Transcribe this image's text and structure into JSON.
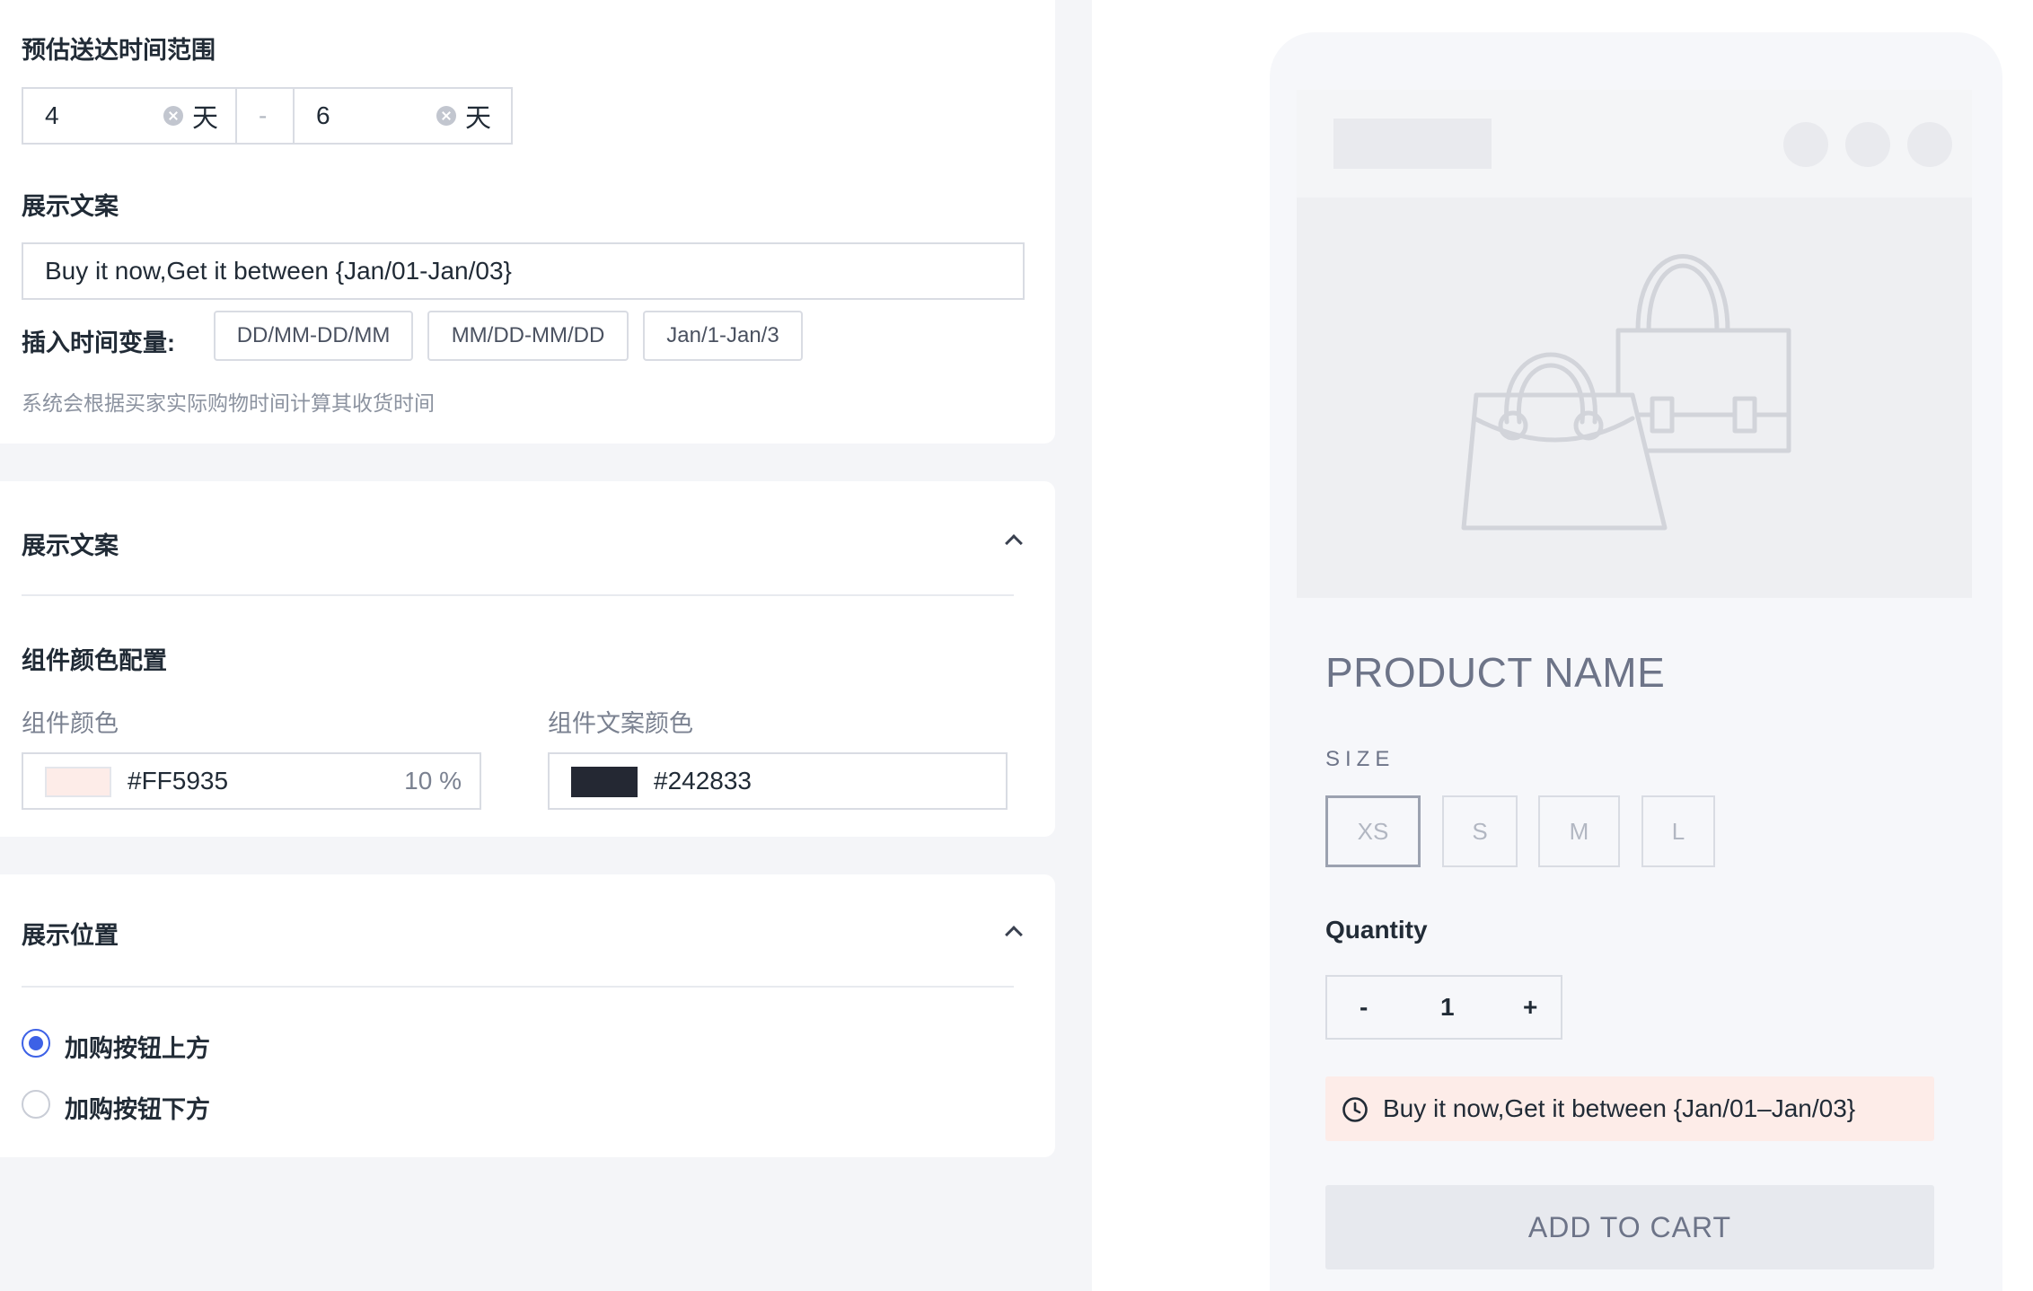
{
  "delivery_range": {
    "title": "预估送达时间范围",
    "min_value": "4",
    "max_value": "6",
    "unit": "天",
    "separator": "-"
  },
  "display_text": {
    "title": "展示文案",
    "value": "Buy it now,Get it between {Jan/01-Jan/03}",
    "insert_label": "插入时间变量:",
    "variables": [
      "DD/MM-DD/MM",
      "MM/DD-MM/DD",
      "Jan/1-Jan/3"
    ],
    "hint": "系统会根据买家实际购物时间计算其收货时间"
  },
  "appearance_section": {
    "title": "展示文案",
    "color_config_title": "组件颜色配置",
    "component_color_label": "组件颜色",
    "component_color_value": "#FF5935",
    "component_color_opacity": "10 %",
    "text_color_label": "组件文案颜色",
    "text_color_value": "#242833",
    "swatch_colors": {
      "component": "#fdece8",
      "text": "#242833"
    }
  },
  "position_section": {
    "title": "展示位置",
    "options": [
      {
        "label": "加购按钮上方",
        "checked": true
      },
      {
        "label": "加购按钮下方",
        "checked": false
      }
    ]
  },
  "preview": {
    "product_name": "PRODUCT NAME",
    "size_label": "SIZE",
    "sizes": [
      "XS",
      "S",
      "M",
      "L"
    ],
    "selected_size": "XS",
    "quantity_label": "Quantity",
    "quantity_minus": "-",
    "quantity_value": "1",
    "quantity_plus": "+",
    "delivery_message": "Buy it now,Get it between {Jan/01–Jan/03}",
    "delivery_icon": "clock-icon",
    "add_to_cart": "ADD TO CART"
  },
  "colors": {
    "accent": "#3d61e6",
    "delivery_bg": "#fdece8",
    "text_dark": "#212b36"
  }
}
